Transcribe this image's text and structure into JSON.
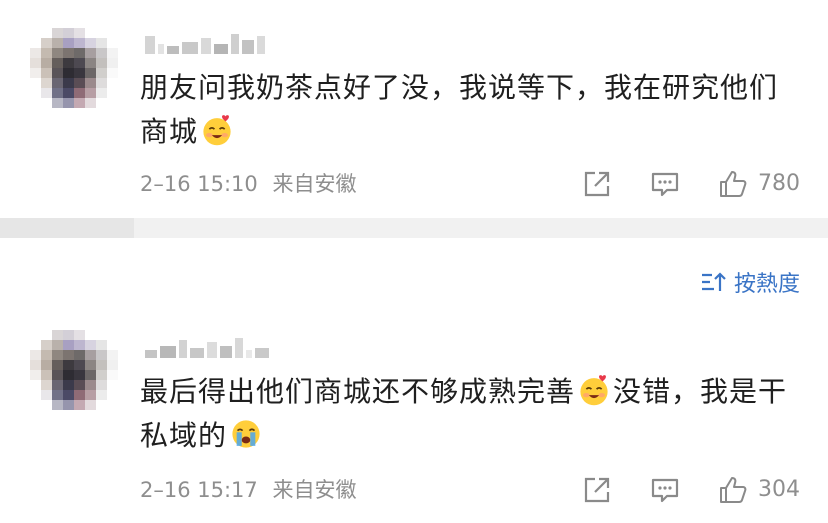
{
  "comments": [
    {
      "text_before_emoji": "朋友问我奶茶点好了没，我说等下，我在研究他们商城",
      "text_after_emoji": "",
      "emoji": "smile-with-heart-emoji",
      "date": "2–16 15:10",
      "location": "来自安徽",
      "likes": "780"
    },
    {
      "text_before_emoji": "最后得出他们商城还不够成熟完善",
      "text_after_emoji": "没错，我是干私域的",
      "emoji": "smile-with-heart-emoji",
      "emoji_end": "crying-emoji",
      "date": "2–16 15:17",
      "location": "来自安徽",
      "likes": "304"
    }
  ],
  "sort": {
    "label": "按熱度",
    "icon": "sort-icon"
  },
  "colors": {
    "link": "#3a74c6",
    "meta": "#8e8e8e",
    "divider": "#f1f1f1",
    "emoji_yellow": "#ffce3b",
    "heart": "#e8394a",
    "tear": "#4aa6ee"
  }
}
